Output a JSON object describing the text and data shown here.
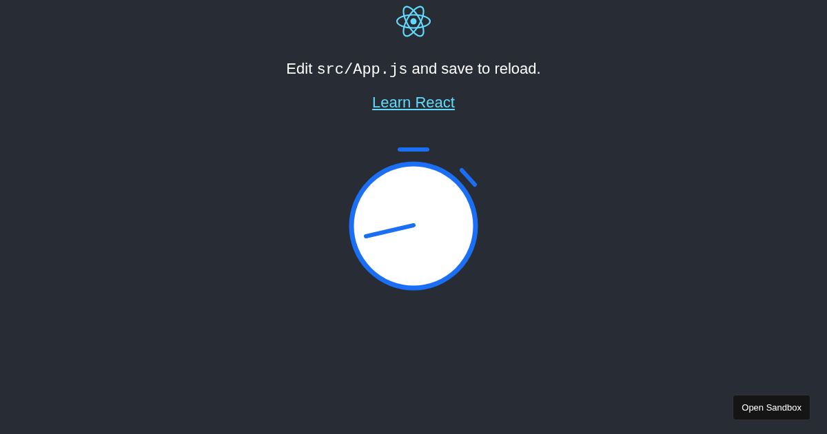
{
  "message": {
    "prefix": "Edit",
    "code": "src/App.js",
    "suffix": "and save to reload."
  },
  "link": {
    "label": "Learn React"
  },
  "sandbox_button": {
    "label": "Open Sandbox"
  }
}
